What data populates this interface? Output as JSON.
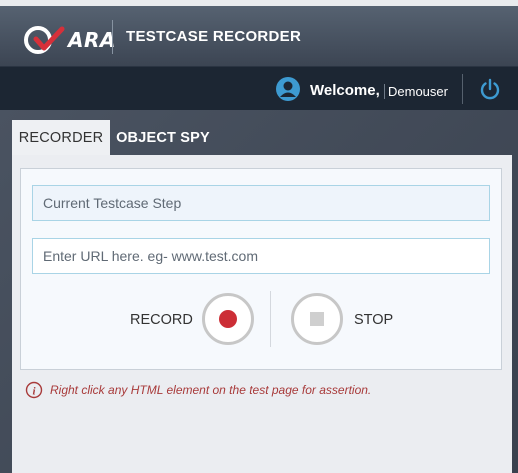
{
  "app": {
    "logo_text": "ARA",
    "title": "TESTCASE RECORDER"
  },
  "user": {
    "welcome": "Welcome,",
    "name": "Demouser"
  },
  "tabs": [
    {
      "label": "RECORDER",
      "active": true
    },
    {
      "label": "OBJECT SPY",
      "active": false
    }
  ],
  "recorder": {
    "step_placeholder": "Current Testcase Step",
    "url_placeholder": "Enter URL here. eg- www.test.com",
    "record_label": "RECORD",
    "stop_label": "STOP"
  },
  "hint": "Right click any HTML element on the test page for assertion.",
  "colors": {
    "header": "#4b5665",
    "userbar": "#1c2633",
    "record": "#cc2e36",
    "accent_blue": "#3d9ad1",
    "hint": "#a83a3a"
  }
}
